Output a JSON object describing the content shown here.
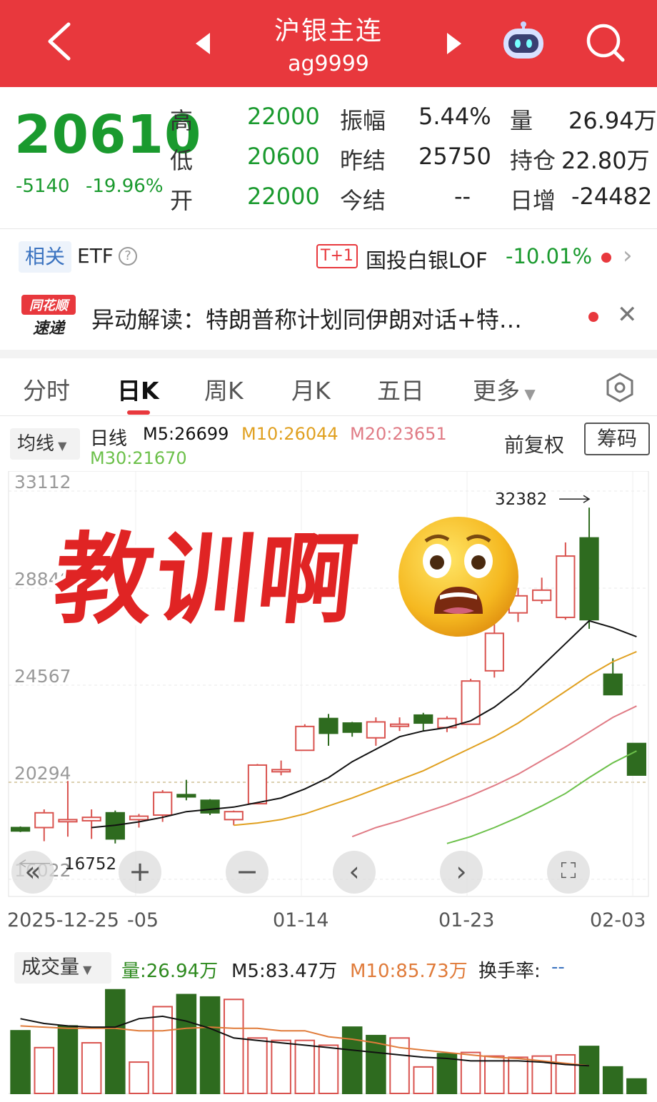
{
  "header": {
    "title": "沪银主连",
    "code": "ag9999"
  },
  "quote": {
    "price": "20610",
    "change": "-5140",
    "change_pct": "-19.96%",
    "rows": [
      {
        "l1": "高",
        "v1": "22000",
        "l2": "振幅",
        "v2": "5.44%",
        "l3": "量",
        "v3": "26.94万"
      },
      {
        "l1": "低",
        "v1": "20600",
        "l2": "昨结",
        "v2": "25750",
        "l3": "持仓",
        "v3": "22.80万"
      },
      {
        "l1": "开",
        "v1": "22000",
        "l2": "今结",
        "v2": "--",
        "l3": "日增",
        "v3": "-24482"
      }
    ]
  },
  "etf": {
    "tag": "相关",
    "label": "ETF",
    "help": "?",
    "t1": "T+1",
    "fund": "国投白银LOF",
    "fund_change": "-10.01%"
  },
  "news": {
    "logo_top": "同花顺",
    "logo_bottom": "速递",
    "text": "异动解读：特朗普称计划同伊朗对话+特…"
  },
  "tabs": [
    "分时",
    "日K",
    "周K",
    "月K",
    "五日",
    "更多"
  ],
  "ma": {
    "selector": "均线",
    "kind": "日线",
    "m5": "M5:26699",
    "m10": "M10:26044",
    "m20": "M20:23651",
    "m30": "M30:21670",
    "adjust": "前复权",
    "chips": "筹码"
  },
  "overlay": {
    "caption": "教训啊"
  },
  "colors": {
    "brand_red": "#e8383d",
    "up": "#d9534f",
    "down": "#2e6b1f",
    "m5": "#111111",
    "m10": "#e0a020",
    "m20": "#e07b85",
    "m30": "#6cc04a"
  },
  "volume_bar": {
    "selector": "成交量",
    "vol": "量:26.94万",
    "m5": "M5:83.47万",
    "m10": "M10:85.73万",
    "turnover_label": "换手率:",
    "turnover_value": "--"
  },
  "chart_data": {
    "type": "candlestick",
    "y_ticks": [
      "33112",
      "28840",
      "24567",
      "20294",
      "16022"
    ],
    "ylim": [
      16022,
      33112
    ],
    "high_marker": "32382",
    "low_marker": "16752",
    "x_labels": [
      "2025-12-25",
      "-05",
      "01-14",
      "01-23",
      "02-03"
    ],
    "candles": [
      {
        "o": 18300,
        "c": 18150,
        "h": 18350,
        "l": 18100
      },
      {
        "o": 18300,
        "c": 18950,
        "h": 19100,
        "l": 17700
      },
      {
        "o": 18650,
        "c": 18650,
        "h": 20350,
        "l": 17900
      },
      {
        "o": 18600,
        "c": 18750,
        "h": 19100,
        "l": 17800
      },
      {
        "o": 18950,
        "c": 17800,
        "h": 19050,
        "l": 17600
      },
      {
        "o": 18650,
        "c": 18800,
        "h": 18900,
        "l": 18300
      },
      {
        "o": 18850,
        "c": 19850,
        "h": 19950,
        "l": 18550
      },
      {
        "o": 19750,
        "c": 19650,
        "h": 20400,
        "l": 19500
      },
      {
        "o": 19500,
        "c": 18950,
        "h": 19550,
        "l": 18850
      },
      {
        "o": 18650,
        "c": 19000,
        "h": 19050,
        "l": 18400
      },
      {
        "o": 19350,
        "c": 21050,
        "h": 21100,
        "l": 19350
      },
      {
        "o": 20850,
        "c": 20850,
        "h": 21250,
        "l": 20600
      },
      {
        "o": 21700,
        "c": 22750,
        "h": 22850,
        "l": 21700
      },
      {
        "o": 23100,
        "c": 22450,
        "h": 23300,
        "l": 21900
      },
      {
        "o": 22900,
        "c": 22500,
        "h": 22950,
        "l": 22300
      },
      {
        "o": 22250,
        "c": 22950,
        "h": 23150,
        "l": 21900
      },
      {
        "o": 22850,
        "c": 22850,
        "h": 23150,
        "l": 22550
      },
      {
        "o": 23250,
        "c": 22900,
        "h": 23350,
        "l": 22550
      },
      {
        "o": 22700,
        "c": 23100,
        "h": 23200,
        "l": 22500
      },
      {
        "o": 22850,
        "c": 24750,
        "h": 24850,
        "l": 22850
      },
      {
        "o": 25200,
        "c": 26850,
        "h": 27650,
        "l": 24900
      },
      {
        "o": 27750,
        "c": 28500,
        "h": 28850,
        "l": 27350
      },
      {
        "o": 28300,
        "c": 28750,
        "h": 29300,
        "l": 28150
      },
      {
        "o": 27550,
        "c": 30250,
        "h": 30850,
        "l": 27450
      },
      {
        "o": 31050,
        "c": 27450,
        "h": 32382,
        "l": 27050
      },
      {
        "o": 25050,
        "c": 24150,
        "h": 25750,
        "l": 24150
      },
      {
        "o": 22000,
        "c": 20610,
        "h": 22000,
        "l": 20600
      }
    ],
    "ma5": [
      null,
      null,
      null,
      18300,
      18400,
      18550,
      18750,
      19000,
      19100,
      19200,
      19400,
      19600,
      20000,
      20500,
      21200,
      21750,
      22300,
      22550,
      22700,
      23000,
      23600,
      24400,
      25400,
      26400,
      27400,
      27100,
      26699
    ],
    "ma10": [
      null,
      null,
      null,
      null,
      null,
      null,
      null,
      null,
      null,
      18400,
      18500,
      18650,
      18900,
      19250,
      19600,
      20000,
      20400,
      20800,
      21300,
      21800,
      22300,
      22900,
      23600,
      24300,
      25000,
      25600,
      26044
    ],
    "ma20": [
      null,
      null,
      null,
      null,
      null,
      null,
      null,
      null,
      null,
      null,
      null,
      null,
      null,
      null,
      17900,
      18300,
      18600,
      18950,
      19300,
      19700,
      20150,
      20650,
      21250,
      21850,
      22500,
      23150,
      23651
    ],
    "ma30": [
      null,
      null,
      null,
      null,
      null,
      null,
      null,
      null,
      null,
      null,
      null,
      null,
      null,
      null,
      null,
      null,
      null,
      null,
      17600,
      17900,
      18300,
      18750,
      19250,
      19800,
      20500,
      21150,
      21670
    ],
    "volume": {
      "values": [
        52,
        38,
        56,
        42,
        86,
        26,
        72,
        82,
        80,
        78,
        46,
        44,
        44,
        40,
        55,
        48,
        46,
        22,
        33,
        34,
        31,
        30,
        31,
        32,
        39,
        22,
        12
      ],
      "up": [
        false,
        true,
        false,
        true,
        false,
        true,
        true,
        false,
        false,
        true,
        true,
        true,
        true,
        true,
        false,
        false,
        true,
        true,
        false,
        true,
        true,
        true,
        true,
        true,
        false,
        false,
        false
      ],
      "m5": [
        62,
        58,
        56,
        55,
        55,
        62,
        64,
        60,
        54,
        46,
        44,
        42,
        40,
        38,
        36,
        34,
        32,
        30,
        29,
        27,
        27,
        27,
        26,
        24,
        23
      ],
      "m10": [
        56,
        55,
        54,
        54,
        54,
        52,
        52,
        54,
        55,
        54,
        54,
        52,
        52,
        47,
        45,
        42,
        38,
        36,
        34,
        32,
        30,
        29,
        27,
        25,
        23
      ]
    }
  }
}
